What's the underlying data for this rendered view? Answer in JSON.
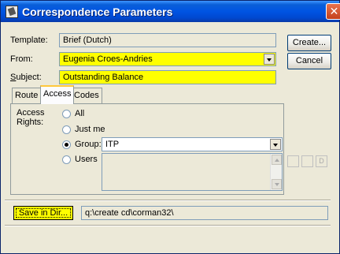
{
  "window": {
    "title": "Correspondence Parameters",
    "close_glyph": "✕",
    "title_color": "#0054e3"
  },
  "form": {
    "template": {
      "label": "Template:",
      "value": "Brief (Dutch)"
    },
    "from": {
      "label": "From:",
      "value": "Eugenia Croes-Andries"
    },
    "subject": {
      "label": "Subject:",
      "value": "Outstanding Balance"
    },
    "highlight_color": "#ffff00"
  },
  "buttons": {
    "create": "Create...",
    "cancel": "Cancel"
  },
  "tabs": [
    {
      "label": "Route",
      "active": false
    },
    {
      "label": "Access",
      "active": true
    },
    {
      "label": "Codes",
      "active": false
    }
  ],
  "access": {
    "label_line1": "Access",
    "label_line2": "Rights:",
    "options": [
      {
        "label": "All",
        "selected": false
      },
      {
        "label": "Just me",
        "selected": false
      },
      {
        "label": "Group:",
        "selected": true
      },
      {
        "label": "Users",
        "selected": false
      }
    ],
    "group_value": "ITP",
    "side_buttons": [
      "",
      "",
      "D"
    ]
  },
  "footer": {
    "save_label": "Save in Dir...",
    "path": "q:\\create cd\\corman32\\"
  }
}
